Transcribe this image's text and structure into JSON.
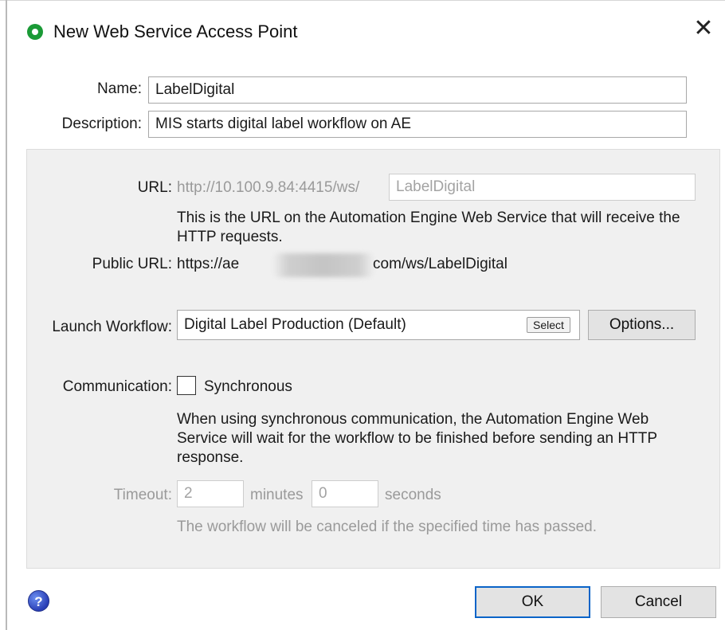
{
  "window": {
    "title": "New Web Service Access Point",
    "close_glyph": "✕",
    "icon": "app-status-icon"
  },
  "form": {
    "name_label": "Name:",
    "name_value": "LabelDigital",
    "description_label": "Description:",
    "description_value": "MIS starts digital label workflow on AE"
  },
  "url": {
    "label": "URL:",
    "prefix": "http://10.100.9.84:4415/ws/",
    "suffix_value": "LabelDigital",
    "help_text": "This is the URL on the Automation Engine Web Service that will receive the HTTP requests."
  },
  "public_url": {
    "label": "Public URL:",
    "value_start": "https://ae",
    "value_end": "com/ws/LabelDigital"
  },
  "workflow": {
    "label": "Launch Workflow:",
    "value": "Digital Label Production (Default)",
    "select_label": "Select",
    "options_label": "Options..."
  },
  "communication": {
    "label": "Communication:",
    "checkbox_label": "Synchronous",
    "checked": false,
    "help_text": "When using synchronous communication, the Automation Engine Web Service will wait for the workflow to be finished before sending an HTTP response."
  },
  "timeout": {
    "label": "Timeout:",
    "minutes_value": "2",
    "minutes_unit": "minutes",
    "seconds_value": "0",
    "seconds_unit": "seconds",
    "help_text": "The workflow will be canceled if the specified time has passed."
  },
  "footer": {
    "help_glyph": "?",
    "ok_label": "OK",
    "cancel_label": "Cancel"
  },
  "colors": {
    "accent": "#0a64c8",
    "app_icon": "#1a9a36",
    "panel_bg": "#f0f0f0"
  }
}
